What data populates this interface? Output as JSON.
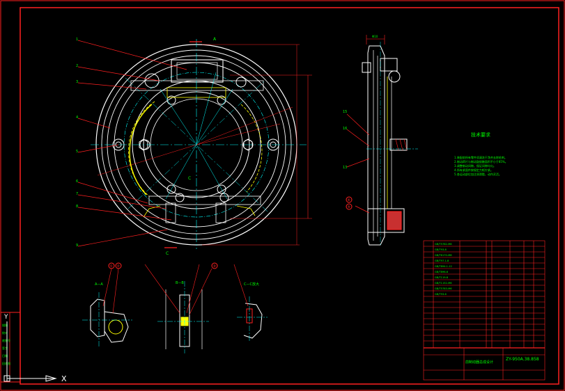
{
  "drawing": {
    "title_block": {
      "drawing_number": "ZY-950A.38.858",
      "drawing_name": "前制动器总成设计"
    },
    "technical_requirements": {
      "heading": "技术要求",
      "notes": [
        "1.装配前所有零件须清洗干净并去除毛刺。",
        "2.制动蹄片与制动鼓接触面积不小于85%。",
        "3.调整制动间隙，保证间隙均匀。",
        "4.所有紧固件按规定力矩拧紧。",
        "5.各运动部位加注润滑脂，动作灵活。"
      ]
    },
    "section_labels": {
      "a": "A—A",
      "b": "B—B",
      "c": "C—C放大"
    },
    "balloons": [
      "①",
      "②",
      "③",
      "④",
      "⑤"
    ],
    "view_marks": {
      "top_a": "A",
      "bottom_c": "C",
      "center_c": "C"
    },
    "ucs": {
      "x": "X",
      "y": "Y"
    },
    "leader_numbers": [
      "1",
      "2",
      "3",
      "4",
      "5",
      "6",
      "7",
      "8",
      "9"
    ],
    "side_numbers": [
      "15",
      "16",
      "13"
    ],
    "dim_side": "Φ10",
    "parts_rows": [
      "GB/T5782-M8",
      "GB/T93-8",
      "GB/T6170-M8",
      "GB/T97.1-8",
      "GB/T894.1-12",
      "GB/T896-6",
      "GB/T119-8",
      "GB/T1152-M6",
      "GB/T5783-M6",
      "GB/T93-6"
    ]
  },
  "colors": {
    "frame": "#ff2020",
    "outline": "#ffffff",
    "centerline": "#00ffff",
    "text": "#00ff00",
    "leader": "#ff2020",
    "hidden": "#ffff00",
    "title_block": "#ff2020"
  }
}
